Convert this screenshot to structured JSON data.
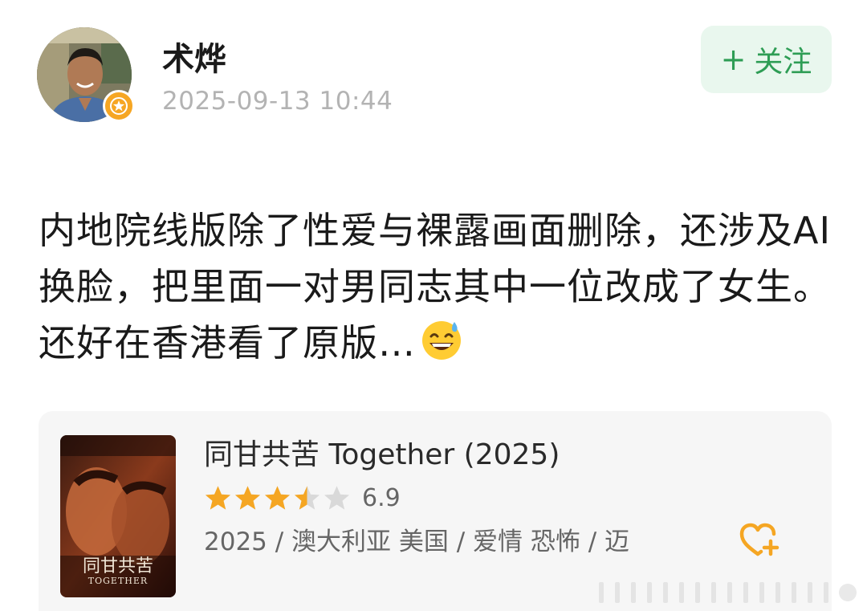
{
  "author": {
    "name": "术烨",
    "timestamp": "2025-09-13 10:44",
    "avatar": "user-photo",
    "badge_icon": "star-badge-icon",
    "badge_color": "#f6a623"
  },
  "follow_button": {
    "icon": "plus-icon",
    "label": "关注",
    "text_color": "#2e9d55",
    "bg_color": "#e9f7ee"
  },
  "post": {
    "text": "内地院线版除了性爱与裸露画面删除，还涉及AI换脸，把里面一对男同志其中一位改成了女生。还好在香港看了原版…",
    "emoji": "grinning-sweat-emoji"
  },
  "movie_card": {
    "title": "同甘共苦 Together (2025)",
    "rating": 6.9,
    "rating_text": "6.9",
    "rating_out_of": 10,
    "stars_filled": 3.5,
    "stars_total": 5,
    "meta": "2025 / 澳大利亚 美国 / 爱情 恐怖 / 迈",
    "poster_title": "同甘共苦",
    "poster_subtitle": "TOGETHER",
    "wishlist_icon": "heart-plus-icon",
    "star_color": "#f5a623",
    "accent_color": "#f5a623"
  }
}
